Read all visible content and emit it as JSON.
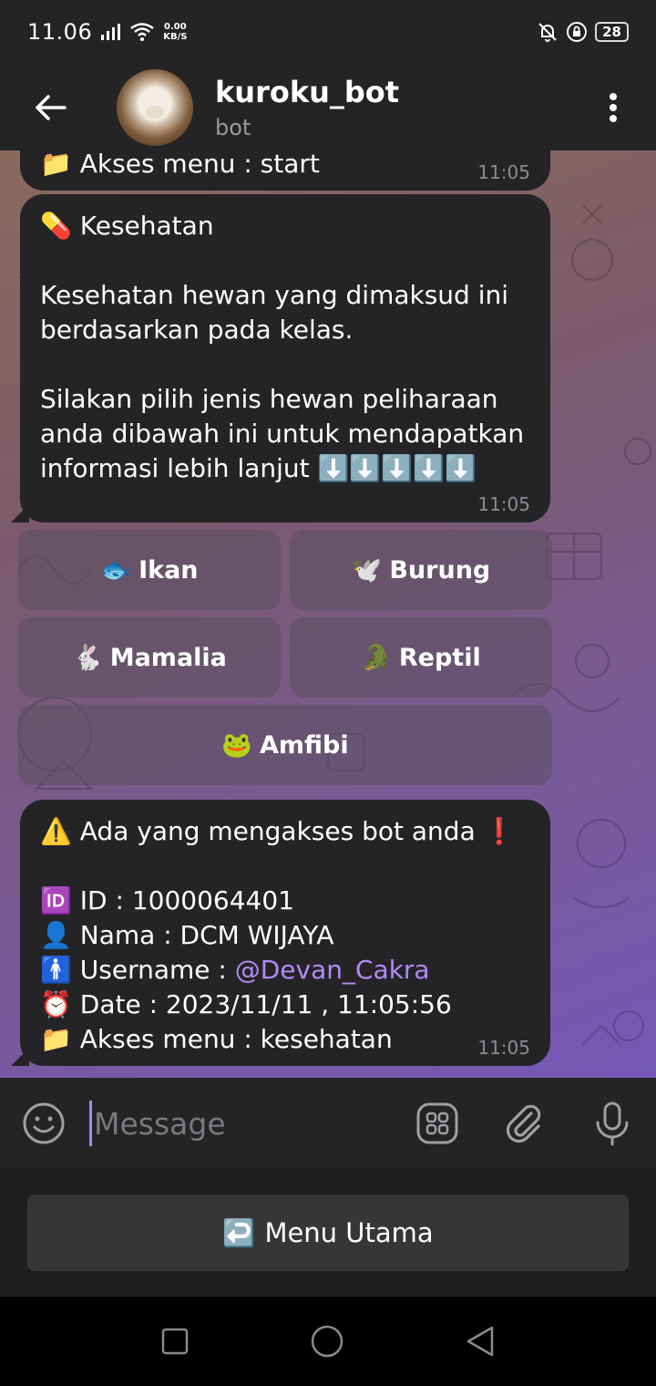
{
  "status": {
    "time": "11.06",
    "speed_value": "0.00",
    "speed_unit": "KB/S",
    "battery": "28"
  },
  "header": {
    "title": "kuroku_bot",
    "subtitle": "bot"
  },
  "messages": [
    {
      "text": "📁 Akses menu : start",
      "time": "11:05"
    },
    {
      "text": "💊 Kesehatan\n\nKesehatan hewan yang dimaksud ini berdasarkan pada kelas.\n\nSilakan pilih jenis hewan peliharaan anda dibawah ini untuk mendapatkan informasi lebih lanjut ⬇️⬇️⬇️⬇️⬇️",
      "time": "11:05"
    },
    {
      "line0": "⚠️ Ada yang mengakses bot anda ❗",
      "line1": "🆔 ID : 1000064401",
      "line2": "👤 Nama : DCM WIJAYA",
      "line3_label": "🚹 Username : ",
      "line3_link": "@Devan_Cakra",
      "line4": "⏰ Date : 2023/11/11 , 11:05:56",
      "line5": "📁 Akses menu : kesehatan",
      "time": "11:05"
    }
  ],
  "inline_keyboard": [
    {
      "emoji": "🐟",
      "label": "Ikan"
    },
    {
      "emoji": "🕊️",
      "label": "Burung"
    },
    {
      "emoji": "🐇",
      "label": "Mamalia"
    },
    {
      "emoji": "🐊",
      "label": "Reptil"
    },
    {
      "emoji": "🐸",
      "label": "Amfibi"
    }
  ],
  "composer": {
    "placeholder": "Message"
  },
  "reply_keyboard": {
    "emoji": "↩️",
    "label": "Menu Utama"
  },
  "icons": {
    "back": "arrow-left-icon",
    "menu": "more-vertical-icon",
    "emoji": "smiley-icon",
    "bot_commands": "grid-icon",
    "attach": "paperclip-icon",
    "mic": "microphone-icon"
  }
}
